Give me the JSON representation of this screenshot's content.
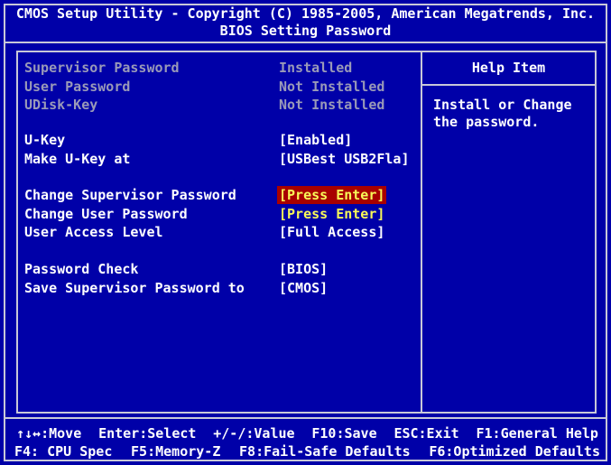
{
  "header": {
    "line1": "CMOS Setup Utility - Copyright (C) 1985-2005, American Megatrends, Inc.",
    "line2": "BIOS Setting Password"
  },
  "settings": [
    {
      "label": "Supervisor Password",
      "value": "Installed",
      "style": "dim"
    },
    {
      "label": "User Password",
      "value": "Not Installed",
      "style": "dim"
    },
    {
      "label": "UDisk-Key",
      "value": "Not Installed",
      "style": "dim"
    },
    {
      "label": "U-Key",
      "value": "[Enabled]",
      "style": "normal"
    },
    {
      "label": "Make U-Key at",
      "value": "[USBest USB2Fla]",
      "style": "normal"
    },
    {
      "label": "Change Supervisor Password",
      "value": "[Press Enter]",
      "style": "selected"
    },
    {
      "label": "Change User Password",
      "value": "[Press Enter]",
      "style": "yellow"
    },
    {
      "label": "User Access Level",
      "value": "[Full Access]",
      "style": "normal"
    },
    {
      "label": "Password Check",
      "value": "[BIOS]",
      "style": "normal"
    },
    {
      "label": "Save Supervisor Password to",
      "value": "[CMOS]",
      "style": "normal"
    }
  ],
  "help": {
    "title": "Help Item",
    "text": "Install or Change the password."
  },
  "footer": {
    "line1": [
      "↑↓↔:Move",
      "Enter:Select",
      "+/-/:Value",
      "F10:Save",
      "ESC:Exit",
      "F1:General Help"
    ],
    "line2": [
      "F4: CPU Spec",
      "F5:Memory-Z",
      "F8:Fail-Safe Defaults",
      "F6:Optimized Defaults"
    ]
  }
}
